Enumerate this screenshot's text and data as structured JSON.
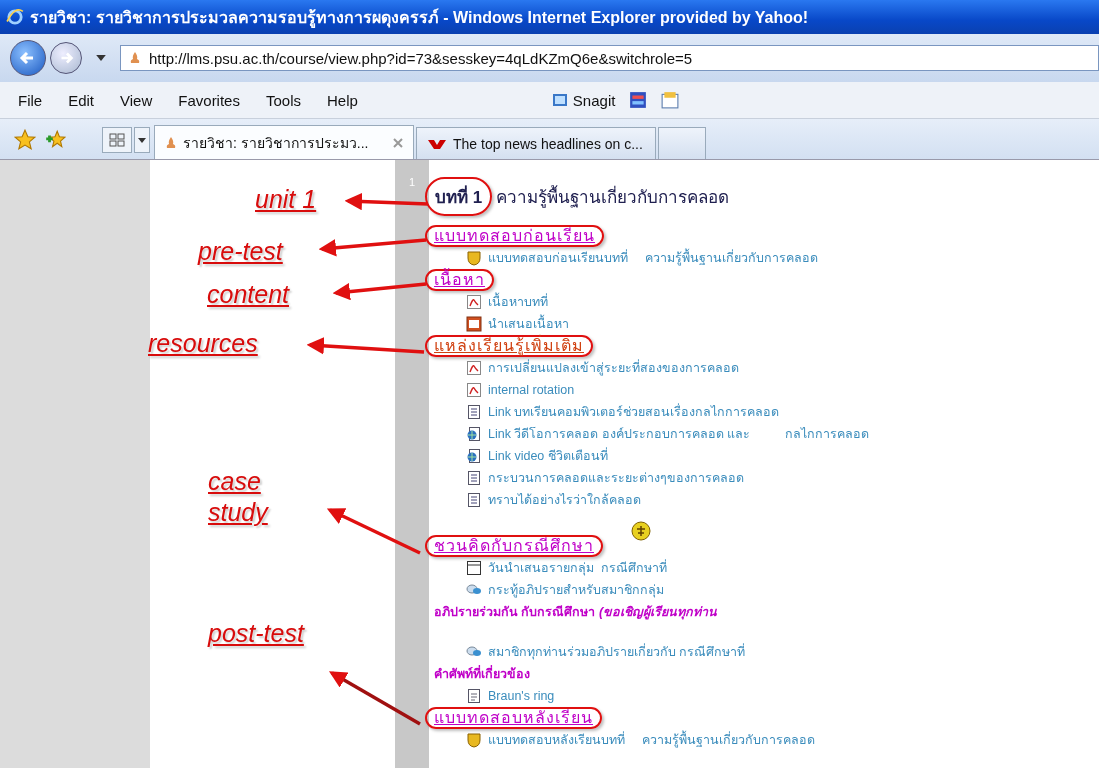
{
  "window": {
    "title": "รายวิชา: รายวิชาการประมวลความรอบรู้ทางการผดุงครรภ์ - Windows Internet Explorer provided by Yahoo!"
  },
  "address_bar": {
    "url": "http://lms.psu.ac.th/course/view.php?id=73&sesskey=4qLdKZmQ6e&switchrole=5"
  },
  "menu": [
    "File",
    "Edit",
    "View",
    "Favorites",
    "Tools",
    "Help"
  ],
  "toolbar": {
    "snagit_label": "Snagit"
  },
  "tabs": [
    {
      "label": "รายวิชา: รายวิชาการประมว...",
      "selected": true
    },
    {
      "label": "The top news headlines on c...",
      "selected": false
    }
  ],
  "course": {
    "section_number": "1",
    "items": [
      {
        "kind": "topic",
        "number": "บทที่ 1",
        "text": "ความรู้พื้นฐานเกี่ยวกับการคลอด",
        "circled": true
      },
      {
        "kind": "label",
        "text": "แบบทดสอบก่อนเรียน",
        "circled": true
      },
      {
        "kind": "quiz",
        "text": "แบบทดสอบก่อนเรียนบทที่     ความรู้พื้นฐานเกี่ยวกับการคลอด"
      },
      {
        "kind": "label",
        "text": "เนื้อหา",
        "circled": true
      },
      {
        "kind": "pdf",
        "text": "เนื้อหาบทที่"
      },
      {
        "kind": "slides",
        "text": "นำเสนอเนื้อหา"
      },
      {
        "kind": "label",
        "text": "แหล่งเรียนรู้เพิ่มเติม",
        "visited": true,
        "circled": true
      },
      {
        "kind": "pdf",
        "text": "การเปลี่ยนแปลงเข้าสู่ระยะที่สองของการคลอด"
      },
      {
        "kind": "pdf",
        "text": "internal rotation"
      },
      {
        "kind": "doc",
        "text": "Link บทเรียนคอมพิวเตอร์ช่วยสอนเรื่องกลไกการคลอด"
      },
      {
        "kind": "web",
        "text": "Link วีดีโอการคลอด องค์ประกอบการคลอด และ          กลไกการคลอด"
      },
      {
        "kind": "web",
        "text": "Link video ชีวิตเตือนที่"
      },
      {
        "kind": "doc",
        "text": "กระบวนการคลอดและระยะต่างๆของการคลอด"
      },
      {
        "kind": "doc",
        "text": "ทราบได้อย่างไรว่าใกล้คลอด"
      },
      {
        "kind": "label",
        "text": "ชวนคิดกับกรณีศึกษา",
        "gap_before": true,
        "badge": true,
        "circled": true
      },
      {
        "kind": "assignment",
        "text": "วันนำเสนอรายกลุ่ม  กรณีศึกษาที่"
      },
      {
        "kind": "forum",
        "text": "กระทู้อภิปรายสำหรับสมาชิกกลุ่ม"
      },
      {
        "kind": "note",
        "text": "อภิปรายร่วมกัน กับกรณีศึกษา *(ขอเชิญผู้เรียนทุกท่าน*"
      },
      {
        "kind": "forum",
        "text": "สมาชิกทุกท่านร่วมอภิปรายเกี่ยวกับ กรณีศึกษาที่",
        "gap_before": true
      },
      {
        "kind": "note",
        "text": "คำศัพท์ที่เกี่ยวข้อง"
      },
      {
        "kind": "glossary",
        "text": "Braun's ring"
      },
      {
        "kind": "label",
        "text": "แบบทดสอบหลังเรียน",
        "circled": true
      },
      {
        "kind": "quiz",
        "text": "แบบทดสอบหลังเรียนบทที่     ความรู้พื้นฐานเกี่ยวกับการคลอด"
      }
    ]
  },
  "annotations": [
    {
      "label": "unit 1"
    },
    {
      "label": "pre-test"
    },
    {
      "label": "content"
    },
    {
      "label": "resources"
    },
    {
      "label": "case study"
    },
    {
      "label": "post-test"
    }
  ]
}
